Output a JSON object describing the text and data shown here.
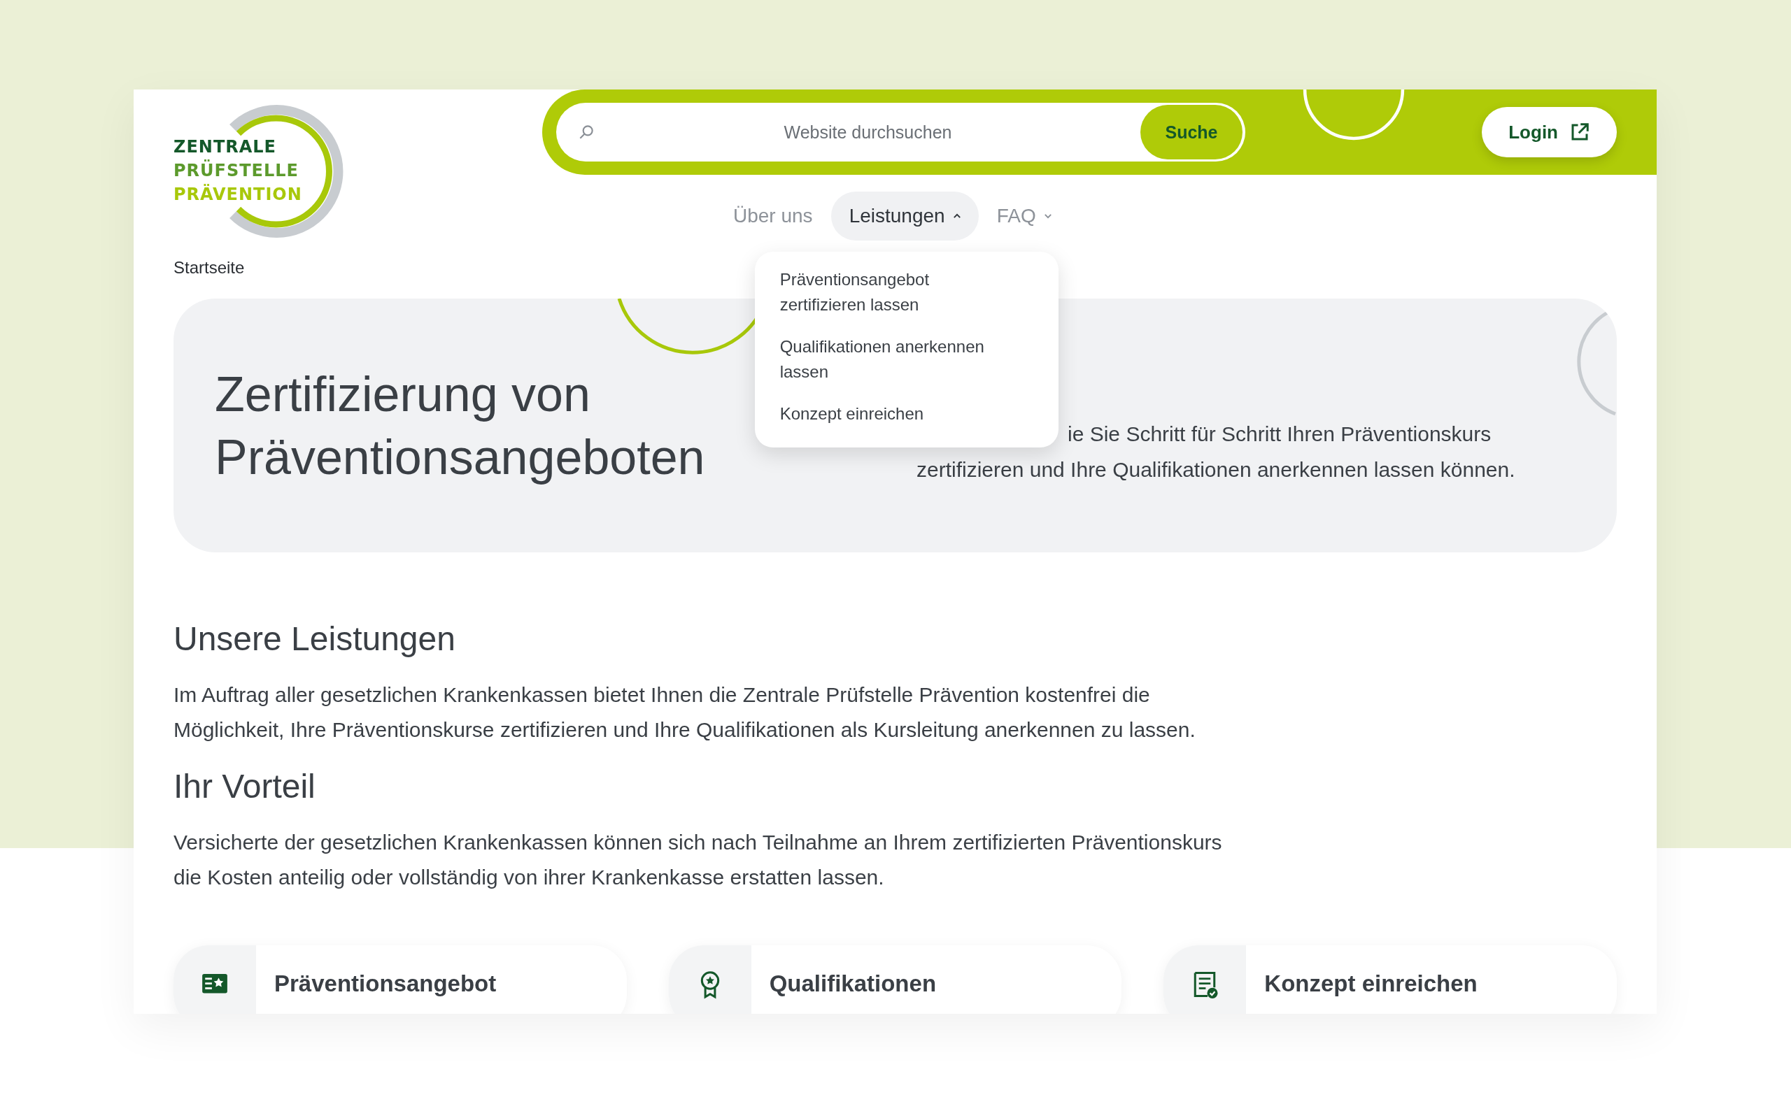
{
  "logo": {
    "lines": [
      {
        "text": "ZENTRALE",
        "color": "#14582a"
      },
      {
        "text": "PRÜFSTELLE",
        "color": "#5c9a2c"
      },
      {
        "text": "PRÄVENTION",
        "color": "#a8c80a"
      }
    ]
  },
  "search": {
    "placeholder": "Website durchsuchen",
    "button": "Suche"
  },
  "login": {
    "label": "Login"
  },
  "nav": [
    {
      "label": "Über uns",
      "kind": "link",
      "selected": false
    },
    {
      "label": "Leistungen",
      "kind": "menu",
      "selected": true,
      "expanded": true
    },
    {
      "label": "FAQ",
      "kind": "menu",
      "selected": false,
      "expanded": false
    }
  ],
  "dropdown": {
    "items": [
      "Präventionsangebot zertifizieren lassen",
      "Qualifikationen anerkennen lassen",
      "Konzept einreichen"
    ]
  },
  "breadcrumb": "Startseite",
  "hero": {
    "title": "Zertifizierung von Präventionsangeboten",
    "text_lines": [
      "ie Sie Schritt für Schritt Ihren Präventionskurs",
      "zertifizieren und Ihre Qualifikationen anerkennen lassen können."
    ]
  },
  "sections": [
    {
      "heading": "Unsere Leistungen",
      "text": "Im Auftrag aller gesetzlichen Krankenkassen bietet Ihnen die Zentrale Prüfstelle Prävention kostenfrei die Möglichkeit, Ihre Präventionskurse zertifizieren und Ihre Qualifikationen als Kursleitung anerkennen zu lassen."
    },
    {
      "heading": "Ihr Vorteil",
      "text": "Versicherte der gesetzlichen Krankenkassen können sich nach Teilnahme an Ihrem zertifizierten Präventionskurs die Kosten anteilig oder vollständig von ihrer Krankenkasse erstatten lassen."
    }
  ],
  "cards": [
    {
      "title": "Präventionsangebot"
    },
    {
      "title": "Qualifikationen"
    },
    {
      "title": "Konzept einreichen"
    }
  ]
}
